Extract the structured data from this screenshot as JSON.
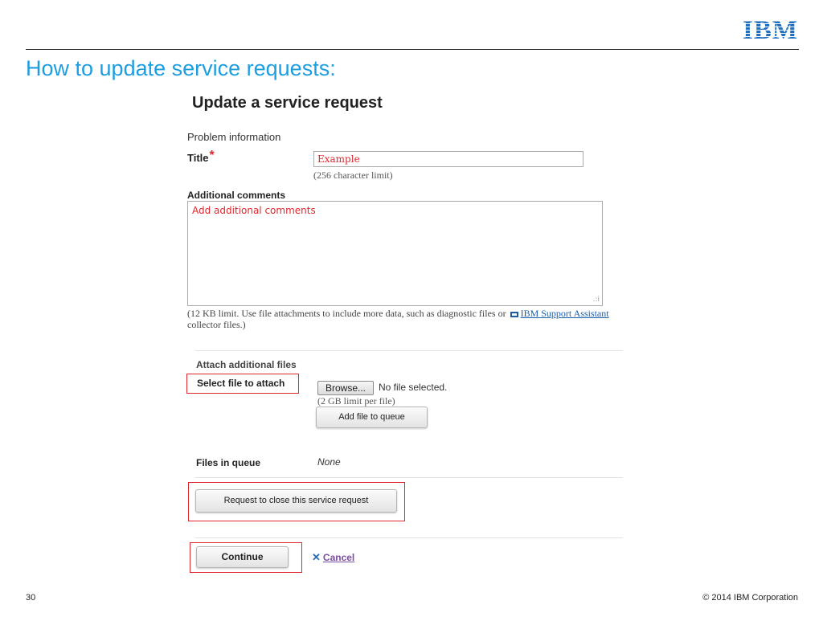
{
  "header": {
    "logo_text": "IBM",
    "slide_title": "How to update service requests:"
  },
  "form": {
    "heading": "Update a service request",
    "section_label": "Problem information",
    "title_label": "Title",
    "required_marker": "*",
    "title_value": "Example",
    "title_hint": "(256 character limit)",
    "comments_label": "Additional comments",
    "comments_value": "Add additional comments",
    "limit_note_before": "(12 KB limit. Use file attachments to include more data, such as diagnostic files or ",
    "limit_link": "IBM Support Assistant",
    "limit_note_after": " collector files.)"
  },
  "attach": {
    "heading": "Attach additional files",
    "select_label": "Select file to attach",
    "browse_label": "Browse...",
    "no_file_text": "No file selected.",
    "size_hint": "(2 GB limit per file)",
    "add_queue_label": "Add file to queue",
    "queue_label": "Files in queue",
    "queue_value": "None"
  },
  "actions": {
    "close_request_label": "Request to close this service request",
    "continue_label": "Continue",
    "cancel_label": "Cancel"
  },
  "footer": {
    "page_number": "30",
    "copyright": "© 2014 IBM Corporation"
  },
  "colors": {
    "accent_blue": "#1d9ee0",
    "highlight_red": "#e0262d",
    "ibm_blue": "#1f70c1"
  },
  "icons": [
    "required-star-icon",
    "external-link-icon",
    "resize-grip-icon",
    "cancel-x-icon"
  ]
}
